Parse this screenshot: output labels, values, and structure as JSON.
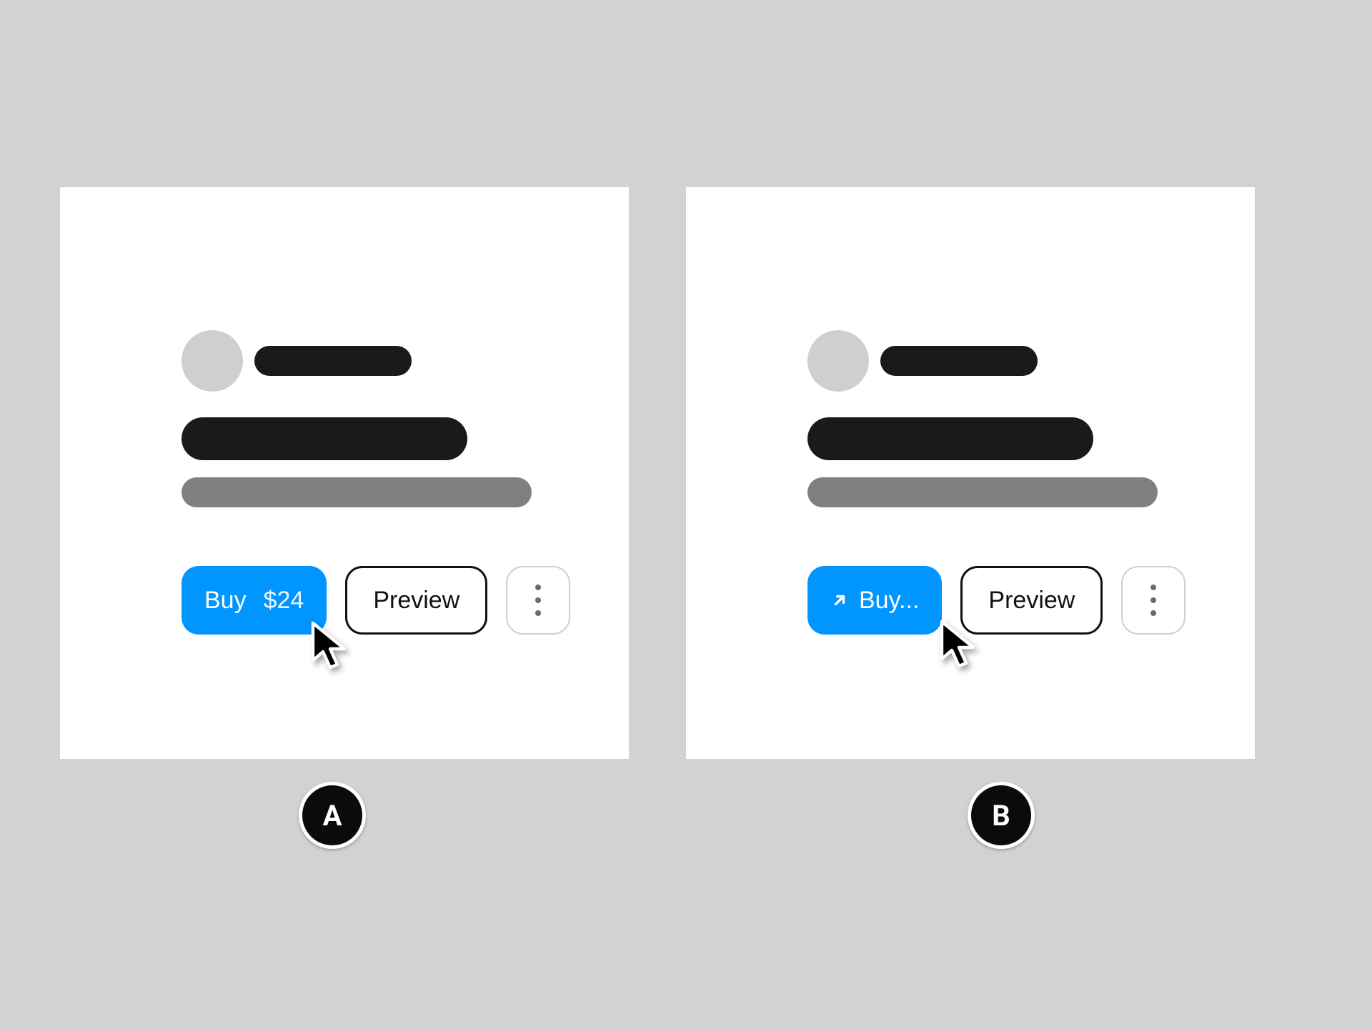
{
  "panel_a": {
    "label": "A",
    "buy_button": {
      "label": "Buy",
      "price": "$24"
    },
    "preview_button": {
      "label": "Preview"
    }
  },
  "panel_b": {
    "label": "B",
    "buy_button": {
      "label": "Buy..."
    },
    "preview_button": {
      "label": "Preview"
    }
  },
  "colors": {
    "primary": "#0095ff",
    "panel_bg": "#ffffff",
    "stage_bg": "#d2d2d2"
  }
}
